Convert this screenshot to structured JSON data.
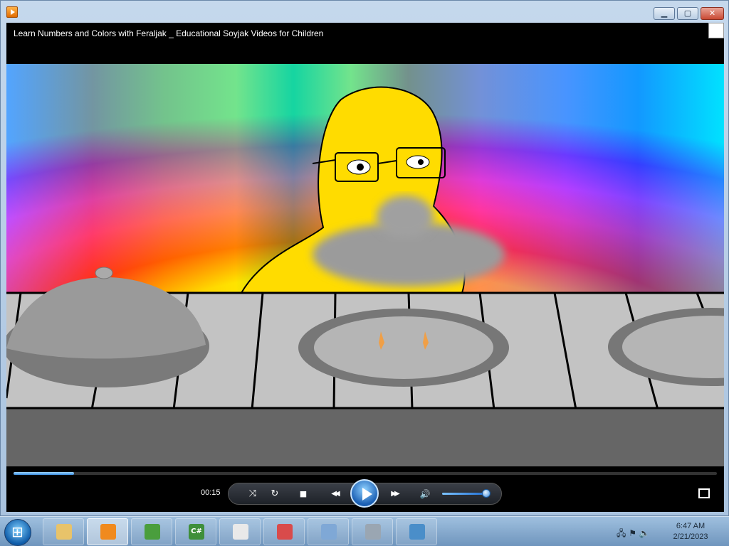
{
  "window": {
    "video_title": "Learn Numbers and Colors with Feraljak _ Educational Soyjak Videos for Children",
    "min_glyph": "▁",
    "max_glyph": "▢",
    "close_glyph": "✕"
  },
  "player": {
    "elapsed": "00:15",
    "seek_progress_fraction": 0.086,
    "volume_level_fraction": 0.9,
    "controls": {
      "shuffle_glyph": "⤨",
      "repeat_glyph": "↻",
      "stop_glyph": "■",
      "rewind_glyph": "◀◀",
      "forward_glyph": "▶▶",
      "volume_glyph": "🔊"
    }
  },
  "taskbar": {
    "apps": [
      {
        "name": "file-explorer",
        "color": "#e8c36a"
      },
      {
        "name": "media-player",
        "color": "#f08a1e"
      },
      {
        "name": "pepe-app",
        "color": "#4a9e3d"
      },
      {
        "name": "csharp-app",
        "color": "#3f8f3a",
        "label": "C#"
      },
      {
        "name": "solitaire",
        "color": "#e9e9e9"
      },
      {
        "name": "snipping-tool",
        "color": "#d94b4b"
      },
      {
        "name": "calendar-gadget",
        "color": "#7fa8d6"
      },
      {
        "name": "speaker-app",
        "color": "#9aa6b2"
      },
      {
        "name": "picture-viewer",
        "color": "#4a8ec9"
      }
    ],
    "time": "6:47 AM",
    "date": "2/21/2023"
  }
}
